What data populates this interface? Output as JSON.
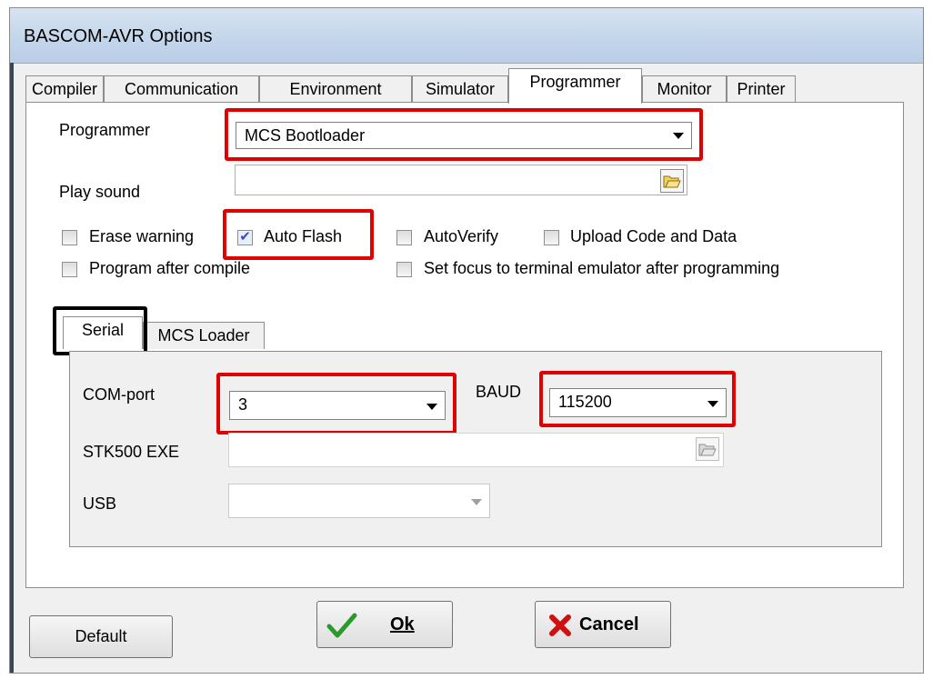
{
  "window": {
    "title": "BASCOM-AVR Options"
  },
  "tabs": [
    {
      "label": "Compiler"
    },
    {
      "label": "Communication"
    },
    {
      "label": "Environment"
    },
    {
      "label": "Simulator"
    },
    {
      "label": "Programmer"
    },
    {
      "label": "Monitor"
    },
    {
      "label": "Printer"
    }
  ],
  "programmer": {
    "label": "Programmer",
    "value": "MCS Bootloader",
    "play_sound_label": "Play sound",
    "play_sound_value": ""
  },
  "checkboxes": {
    "erase_warning": {
      "label": "Erase warning",
      "checked": false
    },
    "auto_flash": {
      "label": "Auto Flash",
      "checked": true
    },
    "auto_verify": {
      "label": "AutoVerify",
      "checked": false
    },
    "upload_code": {
      "label": "Upload Code and Data",
      "checked": false
    },
    "program_after_compile": {
      "label": "Program after compile",
      "checked": false
    },
    "set_focus": {
      "label": "Set focus to terminal emulator after programming",
      "checked": false
    }
  },
  "subtabs": [
    {
      "label": "Serial"
    },
    {
      "label": "MCS Loader"
    }
  ],
  "serial": {
    "com_label": "COM-port",
    "com_value": "3",
    "baud_label": "BAUD",
    "baud_value": "115200",
    "stk_label": "STK500 EXE",
    "stk_value": "",
    "usb_label": "USB",
    "usb_value": ""
  },
  "buttons": {
    "default": "Default",
    "ok": "Ok",
    "cancel": "Cancel"
  },
  "colors": {
    "highlight_red": "#e00000",
    "checkmark_blue": "#3a4fbf",
    "ok_green": "#2a9a2a",
    "cancel_red": "#d01010"
  }
}
